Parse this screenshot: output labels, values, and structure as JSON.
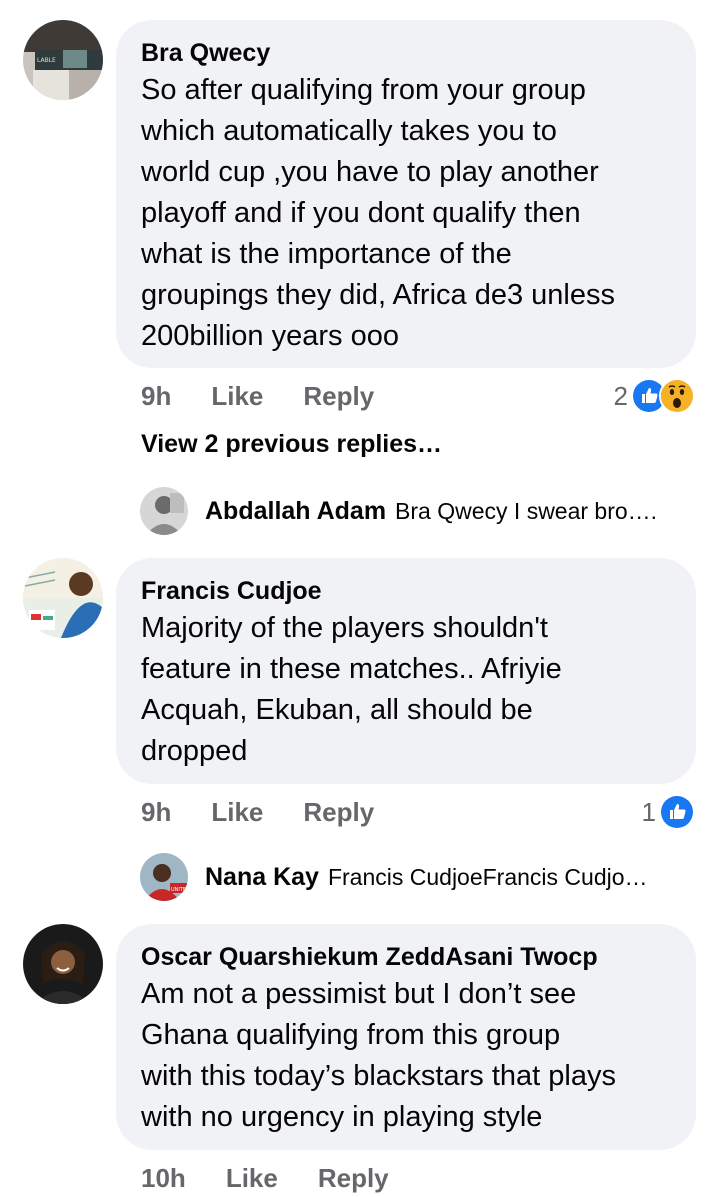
{
  "comments": [
    {
      "author": "Bra Qwecy",
      "text": "So after qualifying from your group\nwhich automatically takes you to\nworld cup ,you have to play another\nplayoff and if you dont qualify then\nwhat is the importance of the\ngroupings they did, Africa de3 unless\n200billion years ooo",
      "time": "9h",
      "like_label": "Like",
      "reply_label": "Reply",
      "reaction_count": "2",
      "reactions": [
        "like-icon",
        "wow-icon"
      ],
      "view_more": "View 2 previous replies…",
      "reply": {
        "author": "Abdallah Adam",
        "text": "Bra Qwecy I swear bro…."
      }
    },
    {
      "author": "Francis Cudjoe",
      "text": "Majority of the players  shouldn't\nfeature in these matches.. Afriyie\nAcquah, Ekuban, all should be\ndropped",
      "time": "9h",
      "like_label": "Like",
      "reply_label": "Reply",
      "reaction_count": "1",
      "reactions": [
        "like-icon"
      ],
      "reply": {
        "author": "Nana Kay",
        "text": "Francis CudjoeFrancis Cudjo…"
      }
    },
    {
      "author": "Oscar Quarshiekum ZeddAsani Twocp",
      "text": "Am not a pessimist but I don’t see\nGhana qualifying from this group\nwith this today’s blackstars that plays\nwith no urgency in playing style",
      "time": "10h",
      "like_label": "Like",
      "reply_label": "Reply"
    }
  ],
  "colors": {
    "bubble": "#f0f2f5",
    "meta": "#65676b",
    "like_blue": "#1877f2",
    "wow_yellow": "#f7b125"
  }
}
